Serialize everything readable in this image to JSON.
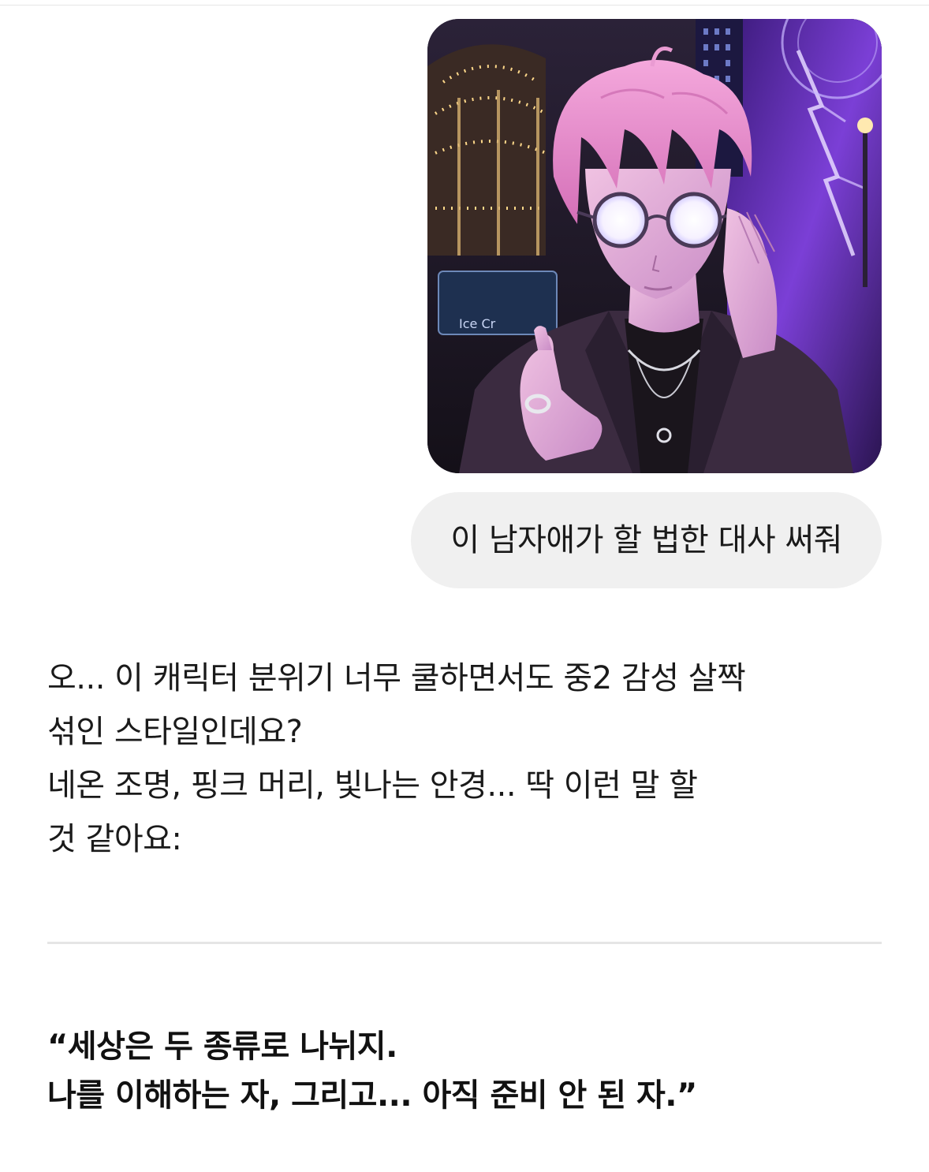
{
  "chat": {
    "user_message": {
      "image_alt": "pink-haired anime boy with glowing round glasses at a neon-lit carnival",
      "image_sign_text": "Ice Cr",
      "text": "이 남자애가 할 법한 대사 써줘"
    },
    "assistant_message": {
      "lines": [
        "오... 이 캐릭터 분위기 너무 쿨하면서도 중2 감성 살짝",
        "섞인 스타일인데요?",
        "네온 조명, 핑크 머리, 빛나는 안경... 딱 이런 말 할",
        "것 같아요:"
      ],
      "quote_lines": [
        "“세상은 두 종류로 나뉘지.",
        "나를 이해하는 자, 그리고... 아직 준비 안 된 자.”"
      ]
    }
  },
  "colors": {
    "bubble_bg": "#f0f0f0",
    "text": "#1a1a1a",
    "divider": "#e5e5e5",
    "hair": "#e78cc9",
    "neon_purple": "#7a3fd0"
  }
}
